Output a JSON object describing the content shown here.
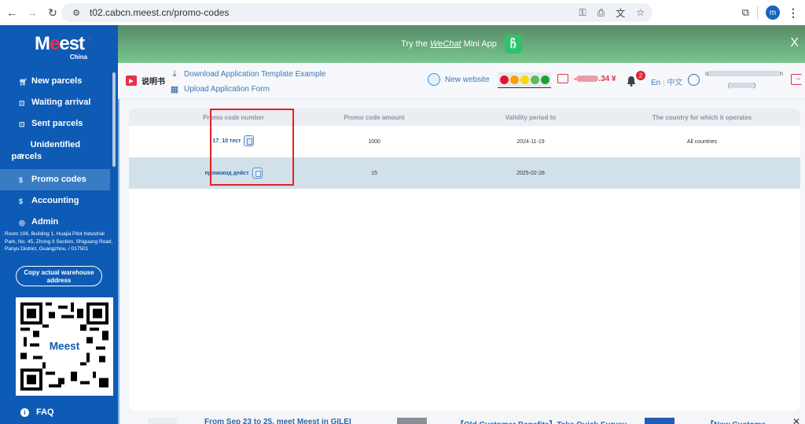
{
  "browser": {
    "url": "t02.cabcn.meest.cn/promo-codes",
    "profile_initial": "m"
  },
  "sidebar": {
    "logo_main": "Meest",
    "logo_sub": "China",
    "items": [
      {
        "label": "New parcels",
        "icon": "cart-icon"
      },
      {
        "label": "Waiting arrival",
        "icon": "inbox-download-icon"
      },
      {
        "label": "Sent parcels",
        "icon": "inbox-upload-icon"
      },
      {
        "label": "Unidentified parcels",
        "icon": "question-circle-icon"
      },
      {
        "label": "Promo codes",
        "icon": "dollar-circle-icon",
        "active": true
      },
      {
        "label": "Accounting",
        "icon": "dollar-circle-icon"
      },
      {
        "label": "Admin",
        "icon": "user-circle-icon"
      }
    ],
    "address": "Room 106, Building 1, Huajia Pilot Industrial Park, No. 45, Zhong II Section, Shiguang Road, Panyu District, Guangzhou. / 017501",
    "copy_address_label": "Copy actual warehouse address",
    "faq_label": "FAQ"
  },
  "banner": {
    "text_before": "Try the ",
    "link": "WeChat",
    "text_after": " Mini App",
    "close": "X"
  },
  "header": {
    "manual_label": "说明书",
    "download_template": "Download Application Template Example",
    "upload_form": "Upload Application Form",
    "new_website": "New website",
    "status_colors": [
      "#e3132c",
      "#f5a00b",
      "#f5d90b",
      "#5db85c",
      "#16a534"
    ],
    "balance_suffix": ".34 ¥",
    "balance_prefix": "-",
    "notifications_count": "2",
    "lang_en": "En",
    "lang_zh": "中文",
    "user_line1_start": "o",
    "user_line1_end": "n",
    "user_line2_start": "(",
    "user_line2_end": ")"
  },
  "table": {
    "columns": [
      "",
      "Promo code number",
      "Promo code amount",
      "Validity period to",
      "The country for which it operates"
    ],
    "rows": [
      {
        "code": "17_10 тест",
        "amount": "1000",
        "validity": "2024-11-19",
        "country": "All countries"
      },
      {
        "code": "промокод дейст",
        "amount": "15",
        "validity": "2025-02-28",
        "country": ""
      }
    ]
  },
  "newsbar": {
    "items": [
      "From Sep 23 to 25, meet Meest in GILEI",
      "【Old Customer Benefits】Take Quick Survey",
      "【New Custome"
    ],
    "close": "✕"
  },
  "colors": {
    "sidebar": "#0d5bb5",
    "accent_red": "#e8304a",
    "highlight": "#e52222"
  }
}
